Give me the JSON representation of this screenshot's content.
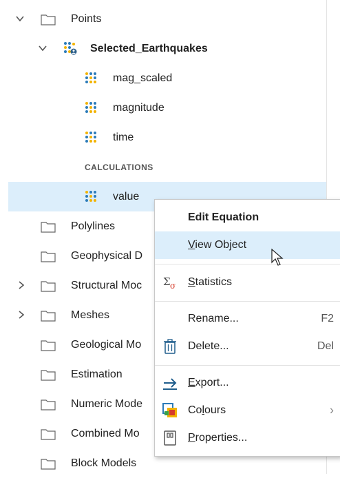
{
  "tree": {
    "points_folder": "Points",
    "selected_object": "Selected_Earthquakes",
    "attrs": [
      "mag_scaled",
      "magnitude",
      "time"
    ],
    "section_calc": "CALCULATIONS",
    "selected_calc": "value",
    "folders": [
      "Polylines",
      "Geophysical D",
      "Structural Moc",
      "Meshes",
      "Geological Mo",
      "Estimation",
      "Numeric Mode",
      "Combined Mo",
      "Block Models"
    ]
  },
  "menu": {
    "edit_equation": "Edit Equation",
    "view_object_pre": "",
    "view_object_u": "V",
    "view_object_post": "iew Object",
    "statistics_u": "S",
    "statistics_post": "tatistics",
    "rename": "Rename...",
    "rename_shortcut": "F2",
    "delete": "Delete...",
    "delete_shortcut": "Del",
    "export_u": "E",
    "export_post": "xport...",
    "colours_pre": "Co",
    "colours_u": "l",
    "colours_post": "ours",
    "colours_arrow": "›",
    "properties_u": "P",
    "properties_post": "roperties..."
  },
  "colors": {
    "selection_bg": "#dceefb",
    "dot_blue": "#2b7bb9",
    "dot_yellow": "#f2b300"
  }
}
